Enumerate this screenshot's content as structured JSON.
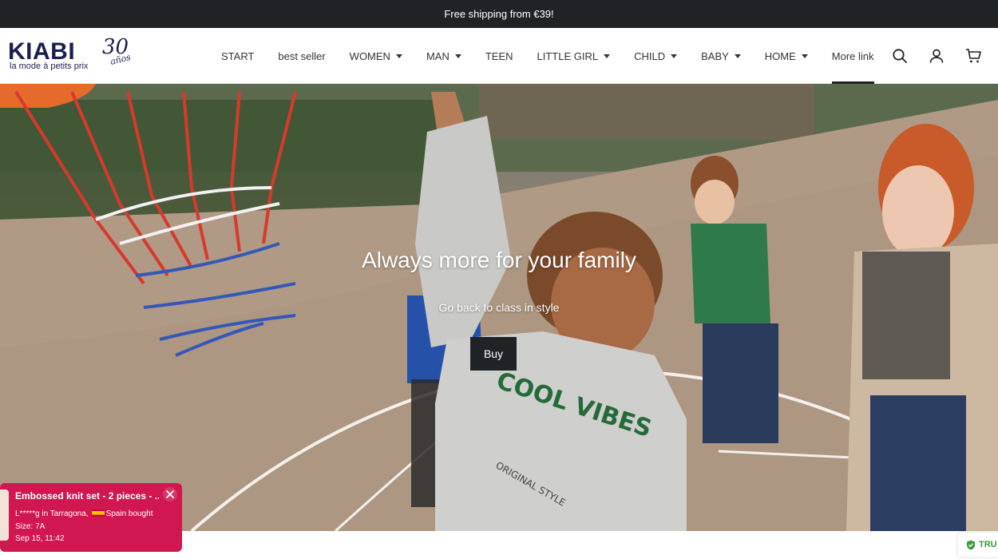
{
  "topbar": {
    "text": "Free shipping from €39!"
  },
  "logo": {
    "brand": "KIABI",
    "tagline": "la mode à petits prix",
    "anniversary": "30",
    "anniversary_sub": "años"
  },
  "nav": {
    "items": [
      {
        "label": "START",
        "dropdown": false
      },
      {
        "label": "best seller",
        "dropdown": false
      },
      {
        "label": "WOMEN",
        "dropdown": true
      },
      {
        "label": "MAN",
        "dropdown": true
      },
      {
        "label": "TEEN",
        "dropdown": false
      },
      {
        "label": "LITTLE GIRL",
        "dropdown": true
      },
      {
        "label": "CHILD",
        "dropdown": true
      },
      {
        "label": "BABY",
        "dropdown": true
      },
      {
        "label": "HOME",
        "dropdown": true
      },
      {
        "label": "More link",
        "dropdown": false,
        "active": true
      }
    ]
  },
  "header_icons": [
    "search-icon",
    "account-icon",
    "cart-icon"
  ],
  "hero": {
    "title": "Always more for your family",
    "subtitle": "Go back to class in style",
    "button": "Buy",
    "shirt_print": "COOL VIBES",
    "shirt_sub": "ORIGINAL STYLE"
  },
  "toast": {
    "title": "Embossed knit set - 2 pieces - ...",
    "buyer": "L*****g in Tarragona,",
    "country": "Spain bought",
    "size": "Size: 7A",
    "date": "Sep 15, 11:42"
  },
  "trust_badge": {
    "text": "TRU"
  },
  "colors": {
    "topbar": "#1f2326",
    "brand": "#1c1f4d",
    "toast": "#d0174f",
    "button": "#1f2326"
  }
}
